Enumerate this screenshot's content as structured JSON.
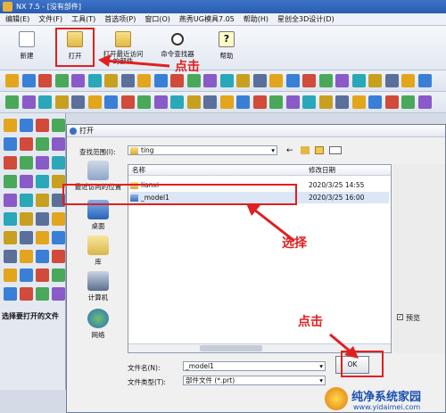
{
  "window": {
    "title": "NX 7.5 - [没有部件]"
  },
  "menubar": [
    "编辑(E)",
    "文件(F)",
    "工具(T)",
    "首选项(P)",
    "窗口(O)",
    "燕秀UG模具7.05",
    "帮助(H)",
    "星创全3D设计(D)"
  ],
  "bigtoolbar": {
    "new_label": "新建",
    "open_label": "打开",
    "recent_label": "打开最近访问的部件",
    "command_finder_label": "命令查找器",
    "help_label": "帮助"
  },
  "leftpanel": {
    "status": "选择要打开的文件"
  },
  "dialog": {
    "title": "打开",
    "lookin_label": "查找范围(I):",
    "lookin_value": "ting",
    "places": [
      "最近访问的位置",
      "桌面",
      "库",
      "计算机",
      "网络"
    ],
    "columns": {
      "name": "名称",
      "date": "修改日期"
    },
    "files": [
      {
        "name": "lianxi",
        "date": "2020/3/25 14:55",
        "type": "folder"
      },
      {
        "name": "_model1",
        "date": "2020/3/25 16:00",
        "type": "prt"
      }
    ],
    "filename_label": "文件名(N):",
    "filename_value": "_model1",
    "filetype_label": "文件类型(T):",
    "filetype_value": "部件文件 (*.prt)",
    "preview_label": "预览",
    "ok_label": "OK"
  },
  "annotations": {
    "click1": "点击",
    "select": "选择",
    "click2": "点击",
    "accent_color": "#e02020"
  },
  "watermark": {
    "title": "纯净系统家园",
    "url": "www.yidaimei.com"
  }
}
